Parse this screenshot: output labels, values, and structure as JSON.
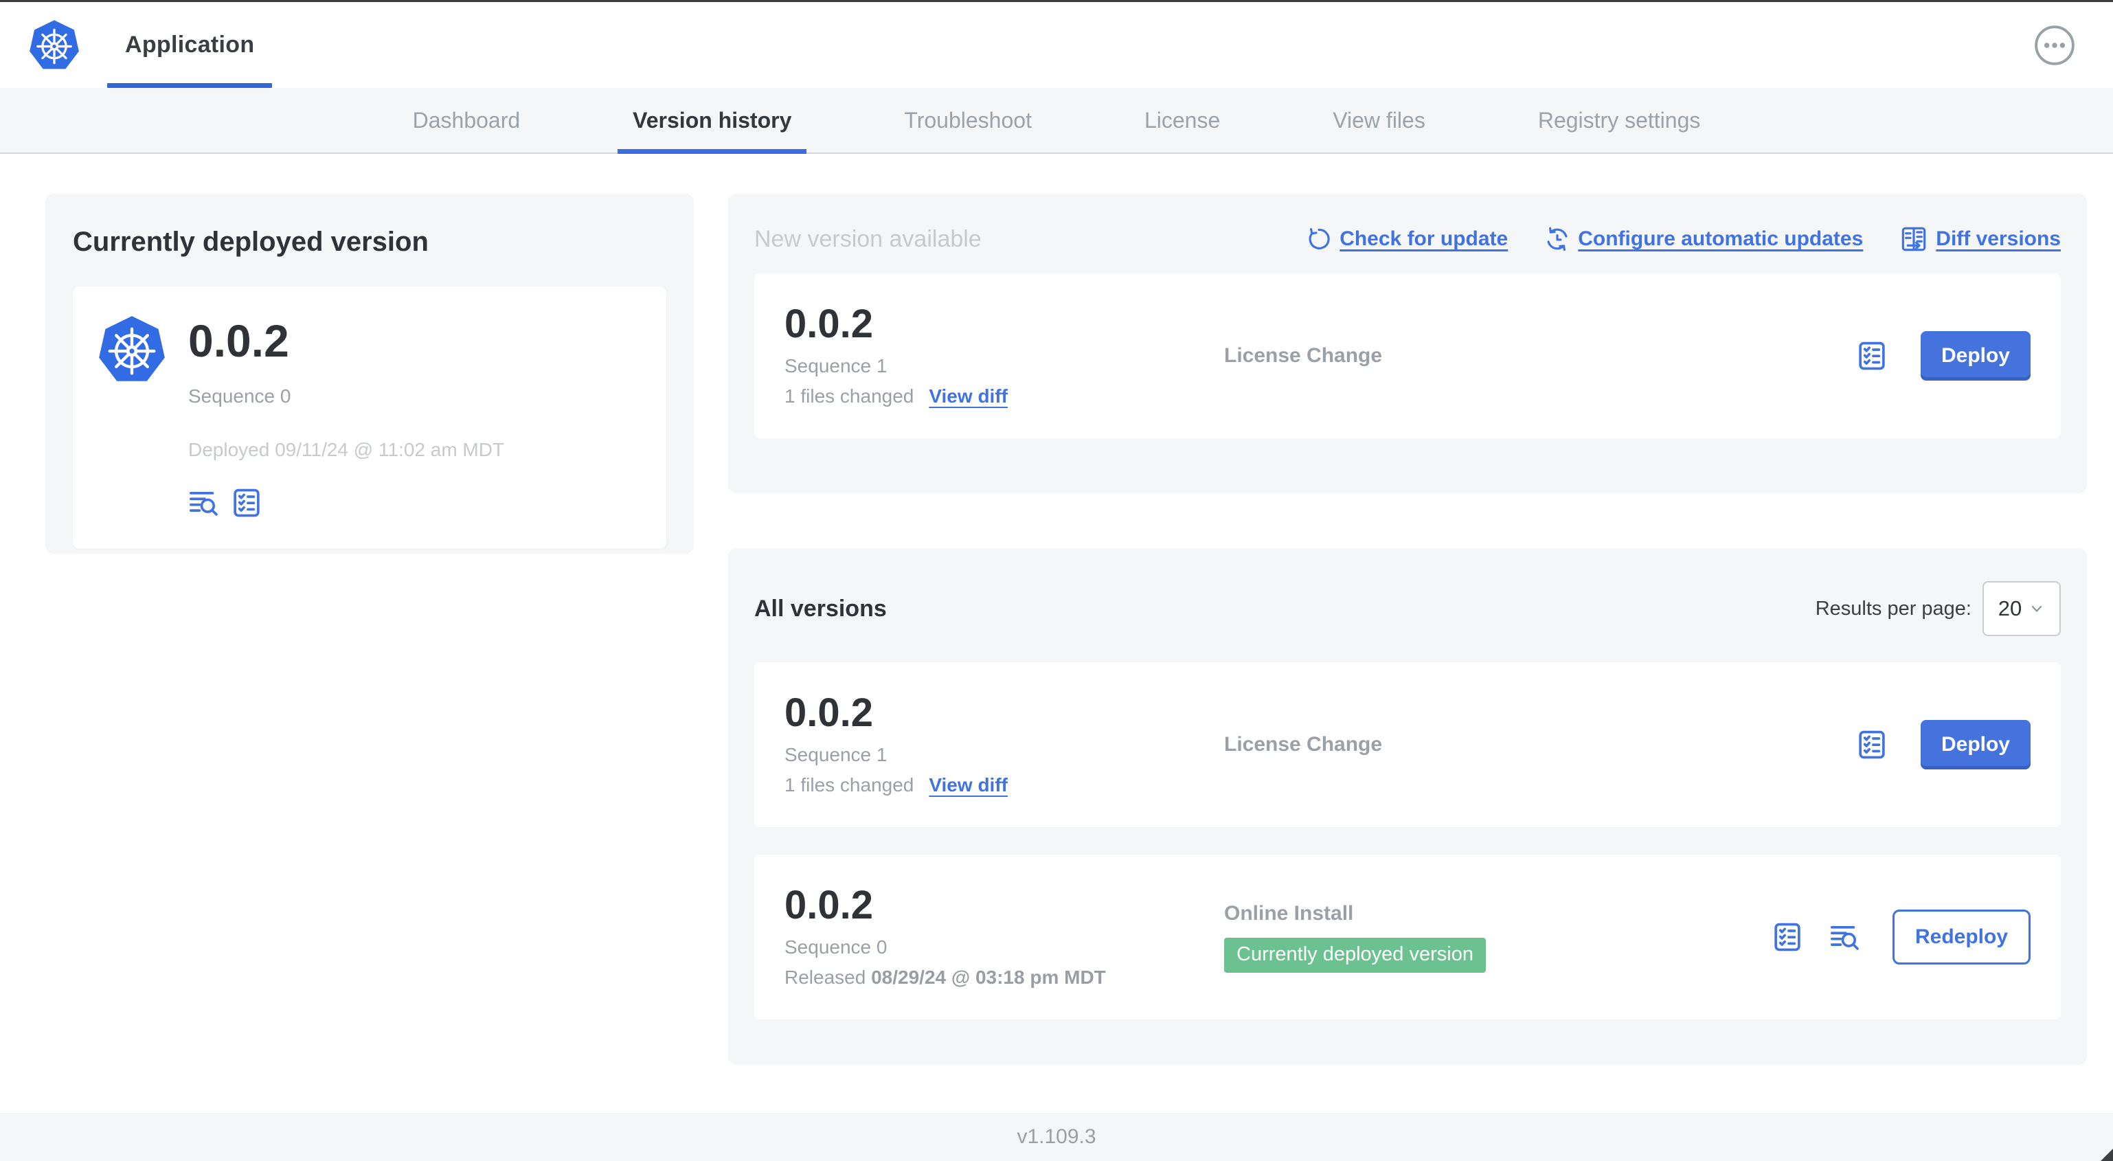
{
  "header": {
    "app_tab_label": "Application"
  },
  "nav": {
    "tabs": [
      "Dashboard",
      "Version history",
      "Troubleshoot",
      "License",
      "View files",
      "Registry settings"
    ],
    "active_tab": "Version history"
  },
  "current_version_panel": {
    "title": "Currently deployed version",
    "version": "0.0.2",
    "sequence_label": "Sequence 0",
    "deployed_label": "Deployed 09/11/24 @ 11:02 am MDT"
  },
  "new_version_panel": {
    "title": "New version available",
    "actions": {
      "check_for_update": "Check for update",
      "configure_automatic_updates": "Configure automatic updates",
      "diff_versions": "Diff versions"
    },
    "card": {
      "version": "0.0.2",
      "sequence_label": "Sequence 1",
      "files_changed_label": "1 files changed",
      "view_diff_label": "View diff",
      "source_label": "License Change",
      "deploy_label": "Deploy"
    }
  },
  "all_versions_panel": {
    "title": "All versions",
    "results_per_page_label": "Results per page:",
    "results_per_page_value": "20",
    "rows": [
      {
        "version": "0.0.2",
        "sequence_label": "Sequence 1",
        "files_changed_label": "1 files changed",
        "view_diff_label": "View diff",
        "source_label": "License Change",
        "action_label": "Deploy"
      },
      {
        "version": "0.0.2",
        "sequence_label": "Sequence 0",
        "released_prefix": "Released ",
        "released_date": "08/29/24 @ 03:18 pm MDT",
        "source_label": "Online Install",
        "badge_label": "Currently deployed version",
        "action_label": "Redeploy"
      }
    ]
  },
  "footer": {
    "app_version": "v1.109.3"
  },
  "icons": {
    "logo": "kubernetes-logo",
    "more": "ellipsis-circle-icon",
    "check_for_update": "refresh-icon",
    "configure_automatic_updates": "clock-refresh-icon",
    "diff_versions": "diff-columns-icon",
    "config": "checklist-icon",
    "logs": "logs-search-icon",
    "select": "chevron-down-icon"
  },
  "colors": {
    "accent_blue": "#4073df",
    "kubernetes_blue": "#326ce5",
    "badge_green": "#6cc191",
    "panel_gray": "#f5f6f8"
  }
}
